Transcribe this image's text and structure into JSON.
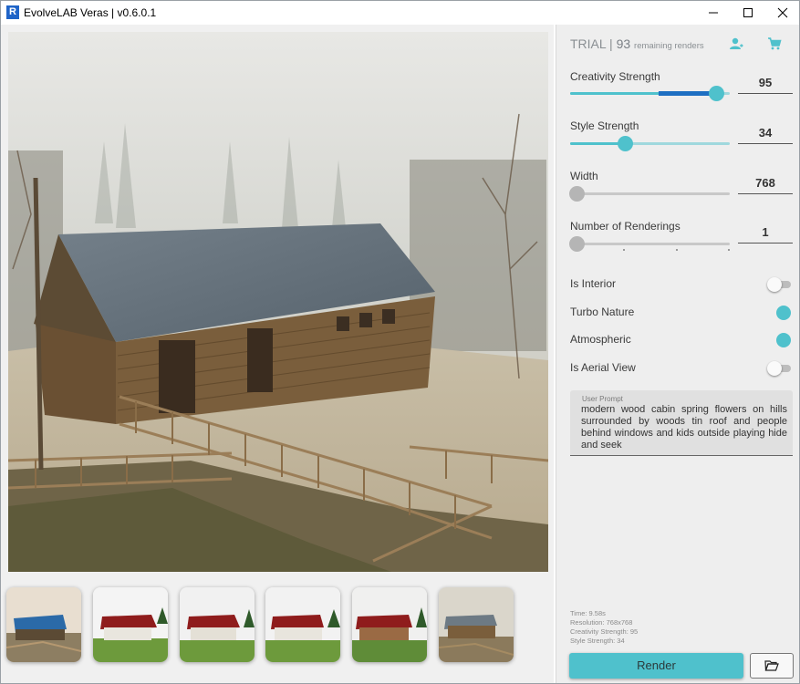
{
  "window": {
    "title": "EvolveLAB Veras | v0.6.0.1",
    "app_icon": "R"
  },
  "header": {
    "trial_label": "TRIAL |",
    "remaining_count": "93",
    "remaining_label": "remaining renders",
    "account_icon": "account-switch-icon",
    "cart_icon": "shopping-cart-icon"
  },
  "sliders": {
    "creativity": {
      "label": "Creativity Strength",
      "value": "95",
      "level": 0.92
    },
    "style": {
      "label": "Style Strength",
      "value": "34",
      "level": 0.35
    },
    "width": {
      "label": "Width",
      "value": "768",
      "level": 0.0
    },
    "renderings": {
      "label": "Number of Renderings",
      "value": "1",
      "level": 0.0
    }
  },
  "toggles": {
    "is_interior": {
      "label": "Is Interior",
      "on": false
    },
    "turbo_nature": {
      "label": "Turbo Nature",
      "on": true
    },
    "atmospheric": {
      "label": "Atmospheric",
      "on": true
    },
    "is_aerial_view": {
      "label": "Is Aerial View",
      "on": false
    }
  },
  "prompt": {
    "label": "User Prompt",
    "text": "modern wood cabin spring flowers on hills surrounded by woods tin roof and people behind windows and kids outside playing hide and seek"
  },
  "stats": {
    "time": "Time: 9.58s",
    "resolution": "Resolution: 768x768",
    "creativity": "Creativity Strength: 95",
    "style": "Style Strength: 34"
  },
  "actions": {
    "render_label": "Render",
    "folder_icon": "folder-open-icon"
  },
  "colors": {
    "accent": "#4fc1cc",
    "accent_dark": "#1e6fc2"
  }
}
